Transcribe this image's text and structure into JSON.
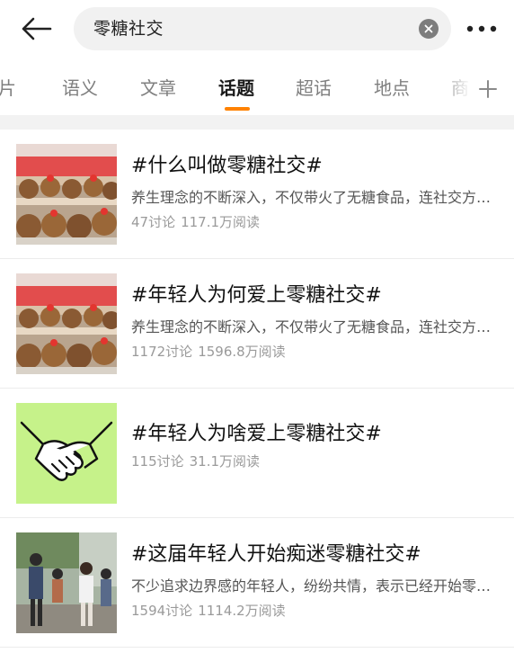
{
  "search": {
    "query": "零糖社交"
  },
  "icons": {
    "back": "arrow-left-icon",
    "clear": "close-circle-icon",
    "more": "more-horizontal-icon",
    "add": "plus-icon"
  },
  "colors": {
    "accent": "#ff8200",
    "tab_inactive": "#7f7f7f",
    "tab_active": "#1a1a1a",
    "meta": "#9a9a9a",
    "thumb_green": "#c6f28a"
  },
  "tabs": [
    {
      "label": "图片",
      "active": false
    },
    {
      "label": "语义",
      "active": false
    },
    {
      "label": "文章",
      "active": false
    },
    {
      "label": "话题",
      "active": true
    },
    {
      "label": "超话",
      "active": false
    },
    {
      "label": "地点",
      "active": false
    },
    {
      "label": "商",
      "active": false
    }
  ],
  "topics": [
    {
      "title": "#什么叫做零糖社交#",
      "desc": "养生理念的不断深入，不仅带火了无糖食品，连社交方式也开始讲究“零糖”了",
      "discussions": "47讨论",
      "reads": "117.1万阅读",
      "thumb": "plush-toys-photo"
    },
    {
      "title": "#年轻人为何爱上零糖社交#",
      "desc": "养生理念的不断深入，不仅带火了无糖食品，连社交方式也开始讲究“零糖”了",
      "discussions": "1172讨论",
      "reads": "1596.8万阅读",
      "thumb": "plush-toys-photo"
    },
    {
      "title": "#年轻人为啥爱上零糖社交#",
      "desc": "",
      "discussions": "115讨论",
      "reads": "31.1万阅读",
      "thumb": "handshake-illustration"
    },
    {
      "title": "#这届年轻人开始痴迷零糖社交#",
      "desc": "不少追求边界感的年轻人，纷纷共情，表示已经开始零糖社交",
      "discussions": "1594讨论",
      "reads": "1114.2万阅读",
      "thumb": "people-street-photo"
    }
  ]
}
